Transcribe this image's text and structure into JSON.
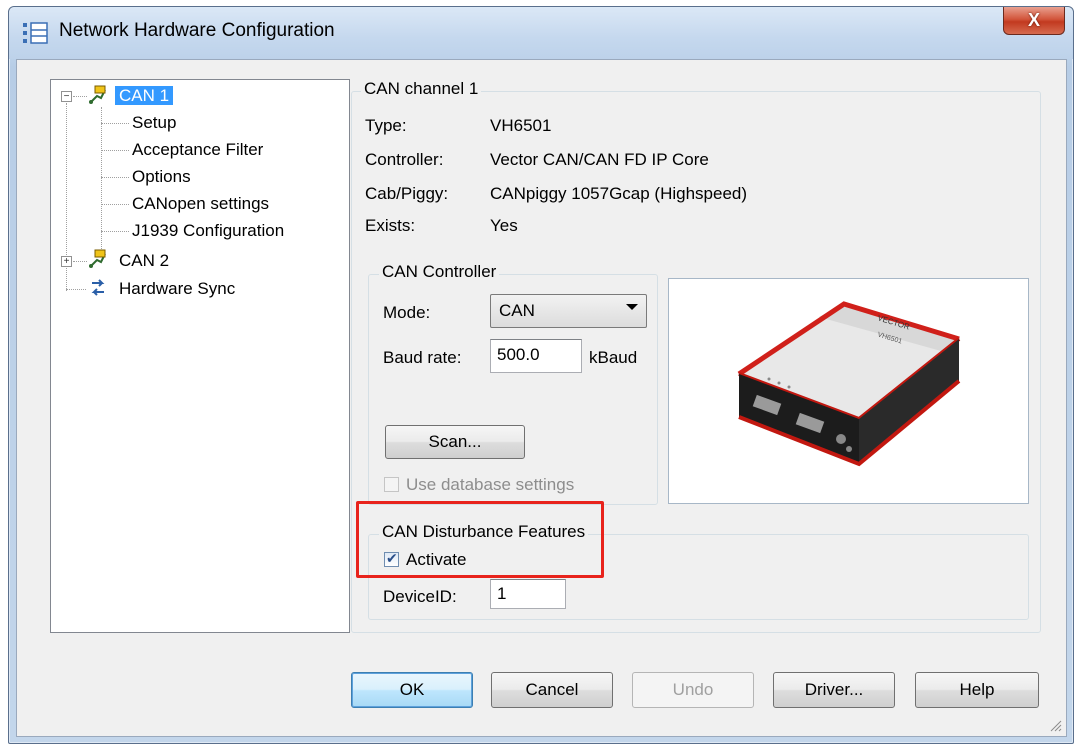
{
  "window": {
    "title": "Network Hardware Configuration",
    "close_label": "X"
  },
  "tree": {
    "can1": "CAN 1",
    "children": [
      "Setup",
      "Acceptance Filter",
      "Options",
      "CANopen settings",
      "J1939 Configuration"
    ],
    "can2": "CAN 2",
    "hw_sync": "Hardware Sync",
    "expander_open": "−",
    "expander_closed": "+"
  },
  "channel": {
    "legend": "CAN channel 1",
    "type_label": "Type:",
    "type_value": "VH6501",
    "controller_label": "Controller:",
    "controller_value": "Vector CAN/CAN FD IP Core",
    "cab_label": "Cab/Piggy:",
    "cab_value": "CANpiggy 1057Gcap (Highspeed)",
    "exists_label": "Exists:",
    "exists_value": "Yes"
  },
  "can_controller": {
    "legend": "CAN Controller",
    "mode_label": "Mode:",
    "mode_value": "CAN",
    "baud_label": "Baud rate:",
    "baud_value": "500.0",
    "baud_unit": "kBaud",
    "scan_label": "Scan...",
    "use_db_label": "Use database settings"
  },
  "disturbance": {
    "legend": "CAN Disturbance Features",
    "activate_label": "Activate",
    "activate_checked": true,
    "device_id_label": "DeviceID:",
    "device_id_value": "1"
  },
  "device_image": {
    "brand": "VECTOR",
    "model": "VH6501"
  },
  "buttons": {
    "ok": "OK",
    "cancel": "Cancel",
    "undo": "Undo",
    "driver": "Driver...",
    "help": "Help"
  },
  "colors": {
    "highlight": "#e8231c",
    "selection": "#3399ff"
  }
}
